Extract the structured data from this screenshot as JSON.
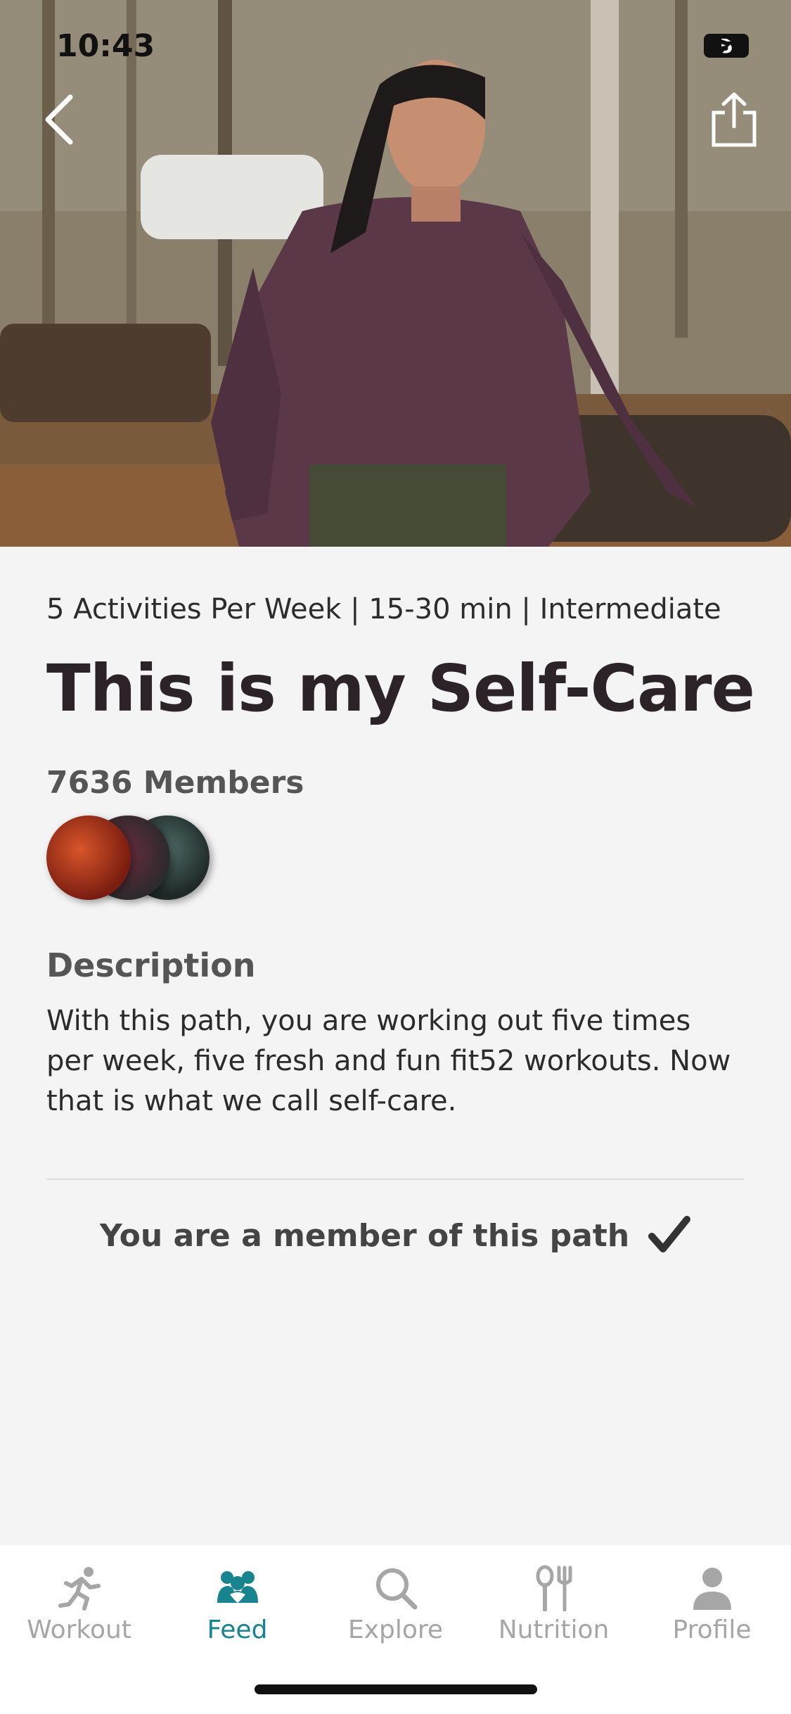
{
  "status_bar": {
    "time": "10:43",
    "battery": "5"
  },
  "path": {
    "meta": "5 Activities Per Week | 15-30 min | Intermediate",
    "title": "This is my Self-Care",
    "members": "7636 Members",
    "description_heading": "Description",
    "description": "With this path, you are working out five times per week, five fresh and fun fit52 workouts. Now that is what we call self-care.",
    "membership_status": "You are a member of this path"
  },
  "tabs": [
    {
      "label": "Workout",
      "icon": "runner-icon",
      "active": false
    },
    {
      "label": "Feed",
      "icon": "people-icon",
      "active": true
    },
    {
      "label": "Explore",
      "icon": "search-icon",
      "active": false
    },
    {
      "label": "Nutrition",
      "icon": "fork-spoon-icon",
      "active": false
    },
    {
      "label": "Profile",
      "icon": "person-icon",
      "active": false
    }
  ],
  "colors": {
    "accent": "#17848f",
    "inactive": "#a6a6a6"
  }
}
